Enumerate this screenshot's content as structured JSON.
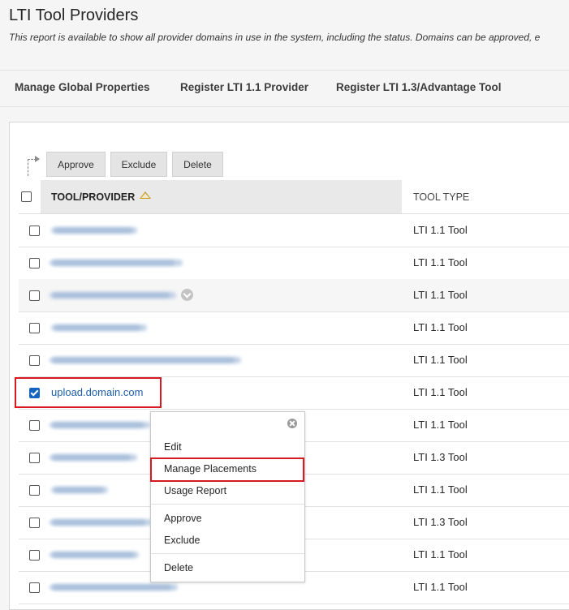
{
  "page": {
    "title": "LTI Tool Providers",
    "description": "This report is available to show all provider domains in use in the system, including the status. Domains can be approved, e"
  },
  "nav": {
    "items": [
      {
        "label": "Manage Global Properties"
      },
      {
        "label": "Register LTI 1.1 Provider"
      },
      {
        "label": "Register LTI 1.3/Advantage Tool"
      }
    ]
  },
  "actions": {
    "approve": "Approve",
    "exclude": "Exclude",
    "delete": "Delete"
  },
  "table": {
    "headers": {
      "tool_provider": "TOOL/PROVIDER",
      "tool_type": "TOOL TYPE"
    },
    "sort_icon": "sort-ascending-icon",
    "rows": [
      {
        "provider": "",
        "tool_type": "LTI 1.1 Tool",
        "checked": false
      },
      {
        "provider": "",
        "tool_type": "LTI 1.1 Tool",
        "checked": false
      },
      {
        "provider": "",
        "tool_type": "LTI 1.1 Tool",
        "checked": false
      },
      {
        "provider": "",
        "tool_type": "LTI 1.1 Tool",
        "checked": false
      },
      {
        "provider": "",
        "tool_type": "LTI 1.1 Tool",
        "checked": false
      },
      {
        "provider": "upload.domain.com",
        "tool_type": "LTI 1.1 Tool",
        "checked": true
      },
      {
        "provider": "",
        "tool_type": "LTI 1.1 Tool",
        "checked": false
      },
      {
        "provider": "",
        "tool_type": "LTI 1.3 Tool",
        "checked": false
      },
      {
        "provider": "",
        "tool_type": "LTI 1.1 Tool",
        "checked": false
      },
      {
        "provider": "",
        "tool_type": "LTI 1.3 Tool",
        "checked": false
      },
      {
        "provider": "",
        "tool_type": "LTI 1.1 Tool",
        "checked": false
      },
      {
        "provider": "",
        "tool_type": "LTI 1.1 Tool",
        "checked": false
      }
    ]
  },
  "context_menu": {
    "items": [
      "Edit",
      "Manage Placements",
      "Usage Report",
      "Approve",
      "Exclude",
      "Delete"
    ],
    "highlighted": "Manage Placements"
  },
  "colors": {
    "link": "#1f5fa8",
    "highlight_border": "#d71920",
    "checkbox_checked": "#1565c0"
  }
}
